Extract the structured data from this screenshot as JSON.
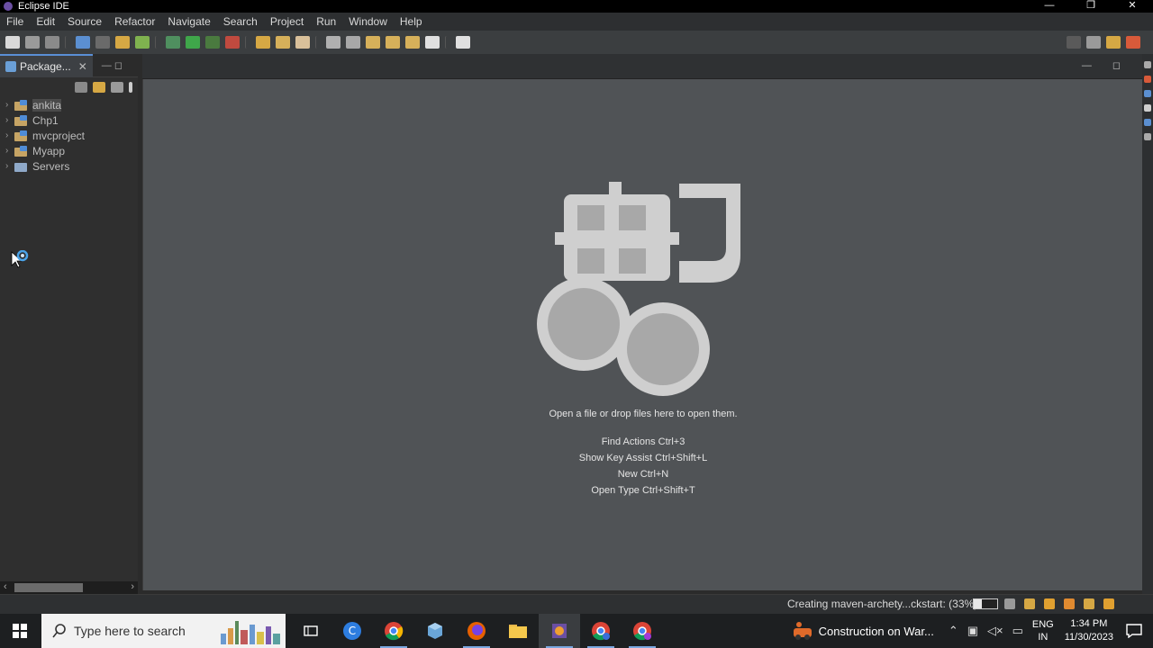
{
  "window": {
    "title": "Eclipse IDE",
    "controls": [
      "—",
      "❐",
      "✕"
    ]
  },
  "menu": [
    "File",
    "Edit",
    "Source",
    "Refactor",
    "Navigate",
    "Search",
    "Project",
    "Run",
    "Window",
    "Help"
  ],
  "explorer": {
    "tab_label": "Package...",
    "tab_close": "✕",
    "tab_controls": "— ◻",
    "projects": [
      {
        "name": "ankita",
        "selected": true,
        "icon": "java-project-icon"
      },
      {
        "name": "Chp1",
        "selected": false,
        "icon": "java-project-icon"
      },
      {
        "name": "mvcproject",
        "selected": false,
        "icon": "java-project-icon"
      },
      {
        "name": "Myapp",
        "selected": false,
        "icon": "java-project-icon"
      },
      {
        "name": "Servers",
        "selected": false,
        "icon": "folder-icon"
      }
    ],
    "scroll_left": "‹",
    "scroll_right": "›"
  },
  "editor": {
    "controls": "— ◻",
    "drop_hint": "Open a file or drop files here to open them.",
    "shortcuts": [
      "Find Actions Ctrl+3",
      "Show Key Assist Ctrl+Shift+L",
      "New Ctrl+N",
      "Open Type Ctrl+Shift+T"
    ]
  },
  "status": {
    "progress_text": "Creating maven-archety...ckstart: (33%)",
    "progress": 0.33
  },
  "taskbar": {
    "search_placeholder": "Type here to search",
    "weather": "Construction on War...",
    "lang_top": "ENG",
    "lang_bottom": "IN",
    "time": "1:34 PM",
    "date": "11/30/2023"
  },
  "colors": {
    "accent": "#5a8fd6",
    "editor_bg": "#505356",
    "logo": "#cfcfcf"
  }
}
